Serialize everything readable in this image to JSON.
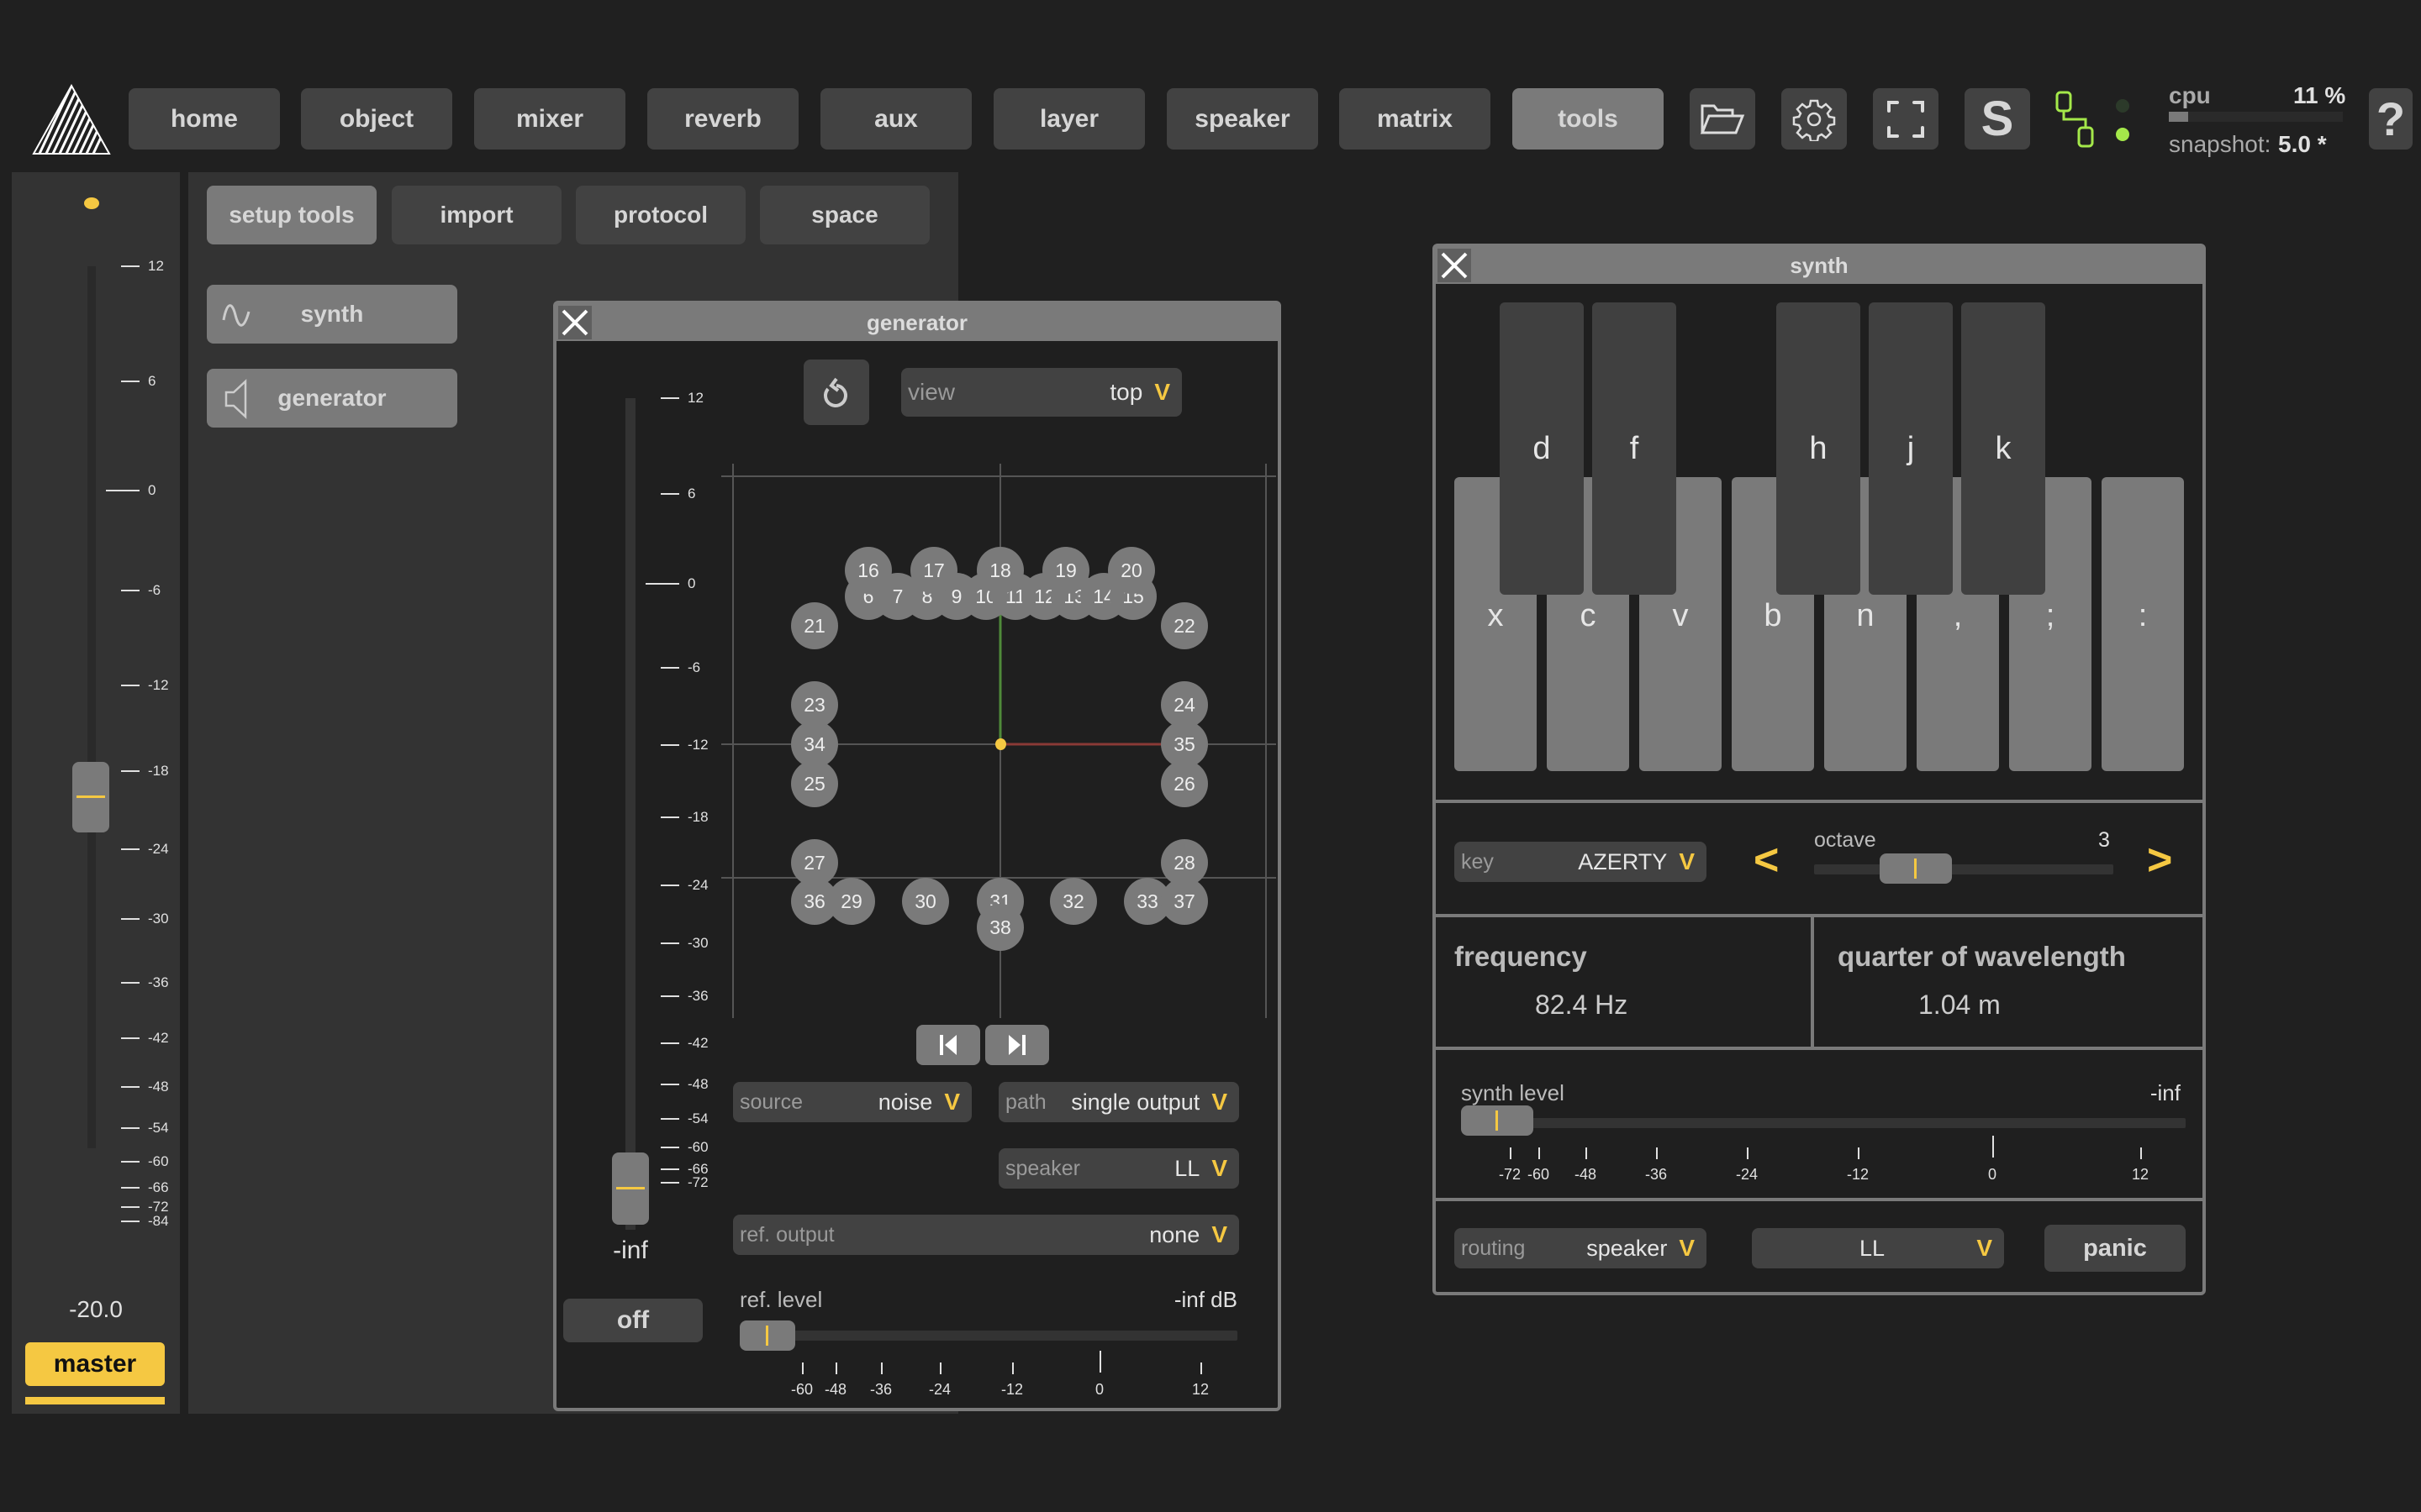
{
  "nav": {
    "items": [
      {
        "label": "home",
        "active": false
      },
      {
        "label": "object",
        "active": false
      },
      {
        "label": "mixer",
        "active": false
      },
      {
        "label": "reverb",
        "active": false
      },
      {
        "label": "aux",
        "active": false
      },
      {
        "label": "layer",
        "active": false
      },
      {
        "label": "speaker",
        "active": false
      },
      {
        "label": "matrix",
        "active": false
      },
      {
        "label": "tools",
        "active": true
      }
    ],
    "icons": [
      "folder-open-icon",
      "gear-icon",
      "fullscreen-icon",
      "s-icon"
    ],
    "s_label": "S",
    "help_label": "?"
  },
  "status": {
    "cpu_label": "cpu",
    "cpu_value": "11 %",
    "cpu_fraction": 0.11,
    "snapshot_label": "snapshot:",
    "snapshot_value": "5.0 *"
  },
  "master": {
    "scale": [
      "12",
      "6",
      "0",
      "-6",
      "-12",
      "-18",
      "-24",
      "-30",
      "-36",
      "-42",
      "-48",
      "-54",
      "-60",
      "-66",
      "-72",
      "-84"
    ],
    "value": "-20.0",
    "value_db": -20.0,
    "label": "master"
  },
  "tools": {
    "tabs": [
      {
        "label": "setup tools",
        "active": true
      },
      {
        "label": "import",
        "active": false
      },
      {
        "label": "protocol",
        "active": false
      },
      {
        "label": "space",
        "active": false
      }
    ],
    "buttons": [
      {
        "label": "synth",
        "icon": "sine-wave-icon"
      },
      {
        "label": "generator",
        "icon": "speaker-icon"
      }
    ]
  },
  "generator": {
    "title": "generator",
    "fader_scale": [
      "12",
      "6",
      "0",
      "-6",
      "-12",
      "-18",
      "-24",
      "-30",
      "-36",
      "-42",
      "-48",
      "-54",
      "-60",
      "-66",
      "-72"
    ],
    "fader_value": "-inf",
    "off_label": "off",
    "view": {
      "label": "view",
      "value": "top"
    },
    "speakers": [
      "6",
      "7",
      "8",
      "9",
      "10",
      "11",
      "12",
      "13",
      "14",
      "15",
      "16",
      "17",
      "18",
      "19",
      "20",
      "21",
      "22",
      "23",
      "24",
      "25",
      "26",
      "27",
      "28",
      "29",
      "30",
      "31",
      "32",
      "33",
      "34",
      "35",
      "36",
      "37",
      "38"
    ],
    "source": {
      "label": "source",
      "value": "noise"
    },
    "path": {
      "label": "path",
      "value": "single output"
    },
    "speaker": {
      "label": "speaker",
      "value": "LL"
    },
    "ref_output": {
      "label": "ref. output",
      "value": "none"
    },
    "ref_level": {
      "label": "ref. level",
      "value": "-inf dB",
      "scale": [
        "-60",
        "-48",
        "-36",
        "-24",
        "-12",
        "0",
        "12"
      ]
    }
  },
  "synth": {
    "title": "synth",
    "white_keys": [
      "x",
      "c",
      "v",
      "b",
      "n",
      ",",
      ";",
      ":"
    ],
    "black_keys": [
      "d",
      "f",
      "h",
      "j",
      "k"
    ],
    "key": {
      "label": "key",
      "value": "AZERTY"
    },
    "octave": {
      "label": "octave",
      "value": "3",
      "prev": "<",
      "next": ">"
    },
    "frequency": {
      "label": "frequency",
      "value": "82.4 Hz"
    },
    "wavelength": {
      "label": "quarter of wavelength",
      "value": "1.04 m"
    },
    "level": {
      "label": "synth level",
      "value": "-inf",
      "scale": [
        "-72",
        "-60",
        "-48",
        "-36",
        "-24",
        "-12",
        "0",
        "12"
      ]
    },
    "routing": {
      "label": "routing",
      "value": "speaker"
    },
    "output": {
      "value": "LL"
    },
    "panic_label": "panic"
  },
  "colors": {
    "accent": "#f5c842",
    "link_green": "#a4e84a",
    "axis_y": "#4f8a3a",
    "axis_x": "#8a3a36"
  }
}
